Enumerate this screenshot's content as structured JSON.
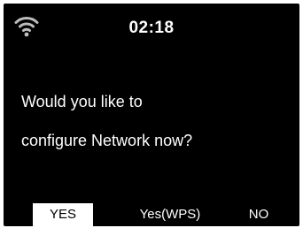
{
  "status_bar": {
    "wifi_icon": "wifi-icon",
    "time": "02:18"
  },
  "dialog": {
    "line1": "Would you like to",
    "line2": "configure Network now?"
  },
  "buttons": {
    "yes": "YES",
    "yes_wps": "Yes(WPS)",
    "no": "NO",
    "selected": "YES"
  },
  "colors": {
    "background": "#000000",
    "text": "#ffffff",
    "selected_bg": "#ffffff",
    "selected_text": "#000000",
    "wifi_icon": "#bdbdbd"
  }
}
